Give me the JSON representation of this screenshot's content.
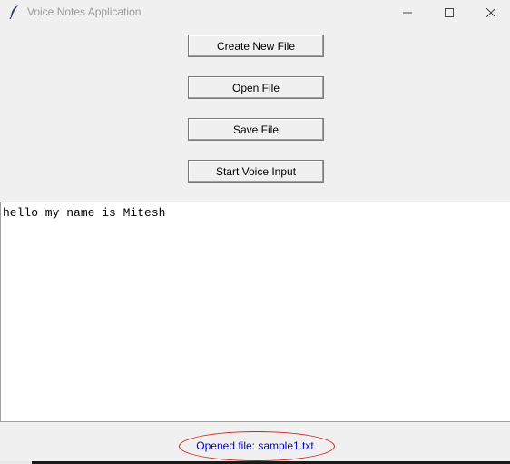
{
  "window": {
    "title": "Voice Notes Application",
    "icon": "feather-icon",
    "controls": {
      "minimize": "minimize-icon",
      "maximize": "maximize-icon",
      "close": "close-icon"
    }
  },
  "buttons": {
    "create": "Create New File",
    "open": "Open File",
    "save": "Save File",
    "voice": "Start Voice Input"
  },
  "editor": {
    "content": "hello my name is Mitesh"
  },
  "status": {
    "text": "Opened file: sample1.txt",
    "color": "#0000cc",
    "highlight_color": "#cc2222"
  }
}
